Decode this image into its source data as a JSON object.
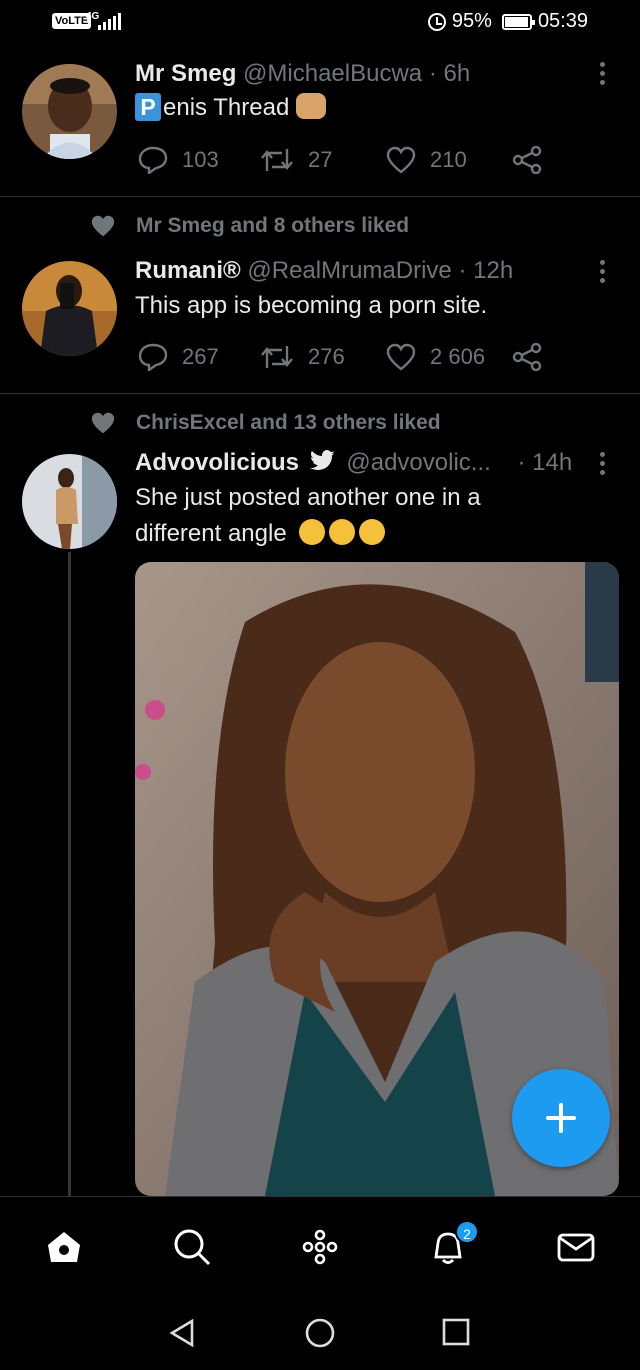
{
  "status_bar": {
    "volte": "VoLTE",
    "network": "4G",
    "battery": "95%",
    "time": "05:39"
  },
  "tweets": [
    {
      "name": "Mr Smeg",
      "handle": "@MichaelBucwa",
      "dot": "·",
      "time": "6h",
      "text_badge": "P",
      "text": "enis Thread",
      "replies": "103",
      "retweets": "27",
      "likes": "210"
    },
    {
      "liked_by": "Mr Smeg and 8 others liked",
      "name": "Rumani®",
      "handle": "@RealMrumaDrive",
      "dot": "·",
      "time": "12h",
      "text": "This app is becoming a porn site.",
      "replies": "267",
      "retweets": "276",
      "likes": "2 606"
    },
    {
      "liked_by": "ChrisExcel and 13 others liked",
      "name": "Advovolicious",
      "handle": "@advovolic...",
      "dot": "·",
      "time": "14h",
      "text_line1": "She just posted another one in a",
      "text_line2": "different angle"
    }
  ],
  "nav": {
    "items": [
      "home-icon",
      "search-icon",
      "spaces-icon",
      "notifications-icon",
      "messages-icon"
    ],
    "notification_count": "2"
  },
  "colors": {
    "accent": "#1d9bf0",
    "muted": "#71767b",
    "text": "#e7e9ea",
    "background": "#000000"
  }
}
